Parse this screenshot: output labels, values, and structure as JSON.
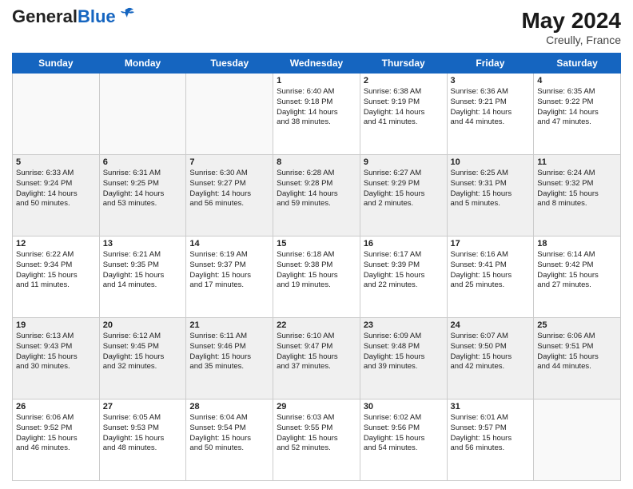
{
  "header": {
    "logo_general": "General",
    "logo_blue": "Blue",
    "month_year": "May 2024",
    "location": "Creully, France"
  },
  "days_of_week": [
    "Sunday",
    "Monday",
    "Tuesday",
    "Wednesday",
    "Thursday",
    "Friday",
    "Saturday"
  ],
  "weeks": [
    [
      {
        "day": "",
        "content": ""
      },
      {
        "day": "",
        "content": ""
      },
      {
        "day": "",
        "content": ""
      },
      {
        "day": "1",
        "content": "Sunrise: 6:40 AM\nSunset: 9:18 PM\nDaylight: 14 hours\nand 38 minutes."
      },
      {
        "day": "2",
        "content": "Sunrise: 6:38 AM\nSunset: 9:19 PM\nDaylight: 14 hours\nand 41 minutes."
      },
      {
        "day": "3",
        "content": "Sunrise: 6:36 AM\nSunset: 9:21 PM\nDaylight: 14 hours\nand 44 minutes."
      },
      {
        "day": "4",
        "content": "Sunrise: 6:35 AM\nSunset: 9:22 PM\nDaylight: 14 hours\nand 47 minutes."
      }
    ],
    [
      {
        "day": "5",
        "content": "Sunrise: 6:33 AM\nSunset: 9:24 PM\nDaylight: 14 hours\nand 50 minutes."
      },
      {
        "day": "6",
        "content": "Sunrise: 6:31 AM\nSunset: 9:25 PM\nDaylight: 14 hours\nand 53 minutes."
      },
      {
        "day": "7",
        "content": "Sunrise: 6:30 AM\nSunset: 9:27 PM\nDaylight: 14 hours\nand 56 minutes."
      },
      {
        "day": "8",
        "content": "Sunrise: 6:28 AM\nSunset: 9:28 PM\nDaylight: 14 hours\nand 59 minutes."
      },
      {
        "day": "9",
        "content": "Sunrise: 6:27 AM\nSunset: 9:29 PM\nDaylight: 15 hours\nand 2 minutes."
      },
      {
        "day": "10",
        "content": "Sunrise: 6:25 AM\nSunset: 9:31 PM\nDaylight: 15 hours\nand 5 minutes."
      },
      {
        "day": "11",
        "content": "Sunrise: 6:24 AM\nSunset: 9:32 PM\nDaylight: 15 hours\nand 8 minutes."
      }
    ],
    [
      {
        "day": "12",
        "content": "Sunrise: 6:22 AM\nSunset: 9:34 PM\nDaylight: 15 hours\nand 11 minutes."
      },
      {
        "day": "13",
        "content": "Sunrise: 6:21 AM\nSunset: 9:35 PM\nDaylight: 15 hours\nand 14 minutes."
      },
      {
        "day": "14",
        "content": "Sunrise: 6:19 AM\nSunset: 9:37 PM\nDaylight: 15 hours\nand 17 minutes."
      },
      {
        "day": "15",
        "content": "Sunrise: 6:18 AM\nSunset: 9:38 PM\nDaylight: 15 hours\nand 19 minutes."
      },
      {
        "day": "16",
        "content": "Sunrise: 6:17 AM\nSunset: 9:39 PM\nDaylight: 15 hours\nand 22 minutes."
      },
      {
        "day": "17",
        "content": "Sunrise: 6:16 AM\nSunset: 9:41 PM\nDaylight: 15 hours\nand 25 minutes."
      },
      {
        "day": "18",
        "content": "Sunrise: 6:14 AM\nSunset: 9:42 PM\nDaylight: 15 hours\nand 27 minutes."
      }
    ],
    [
      {
        "day": "19",
        "content": "Sunrise: 6:13 AM\nSunset: 9:43 PM\nDaylight: 15 hours\nand 30 minutes."
      },
      {
        "day": "20",
        "content": "Sunrise: 6:12 AM\nSunset: 9:45 PM\nDaylight: 15 hours\nand 32 minutes."
      },
      {
        "day": "21",
        "content": "Sunrise: 6:11 AM\nSunset: 9:46 PM\nDaylight: 15 hours\nand 35 minutes."
      },
      {
        "day": "22",
        "content": "Sunrise: 6:10 AM\nSunset: 9:47 PM\nDaylight: 15 hours\nand 37 minutes."
      },
      {
        "day": "23",
        "content": "Sunrise: 6:09 AM\nSunset: 9:48 PM\nDaylight: 15 hours\nand 39 minutes."
      },
      {
        "day": "24",
        "content": "Sunrise: 6:07 AM\nSunset: 9:50 PM\nDaylight: 15 hours\nand 42 minutes."
      },
      {
        "day": "25",
        "content": "Sunrise: 6:06 AM\nSunset: 9:51 PM\nDaylight: 15 hours\nand 44 minutes."
      }
    ],
    [
      {
        "day": "26",
        "content": "Sunrise: 6:06 AM\nSunset: 9:52 PM\nDaylight: 15 hours\nand 46 minutes."
      },
      {
        "day": "27",
        "content": "Sunrise: 6:05 AM\nSunset: 9:53 PM\nDaylight: 15 hours\nand 48 minutes."
      },
      {
        "day": "28",
        "content": "Sunrise: 6:04 AM\nSunset: 9:54 PM\nDaylight: 15 hours\nand 50 minutes."
      },
      {
        "day": "29",
        "content": "Sunrise: 6:03 AM\nSunset: 9:55 PM\nDaylight: 15 hours\nand 52 minutes."
      },
      {
        "day": "30",
        "content": "Sunrise: 6:02 AM\nSunset: 9:56 PM\nDaylight: 15 hours\nand 54 minutes."
      },
      {
        "day": "31",
        "content": "Sunrise: 6:01 AM\nSunset: 9:57 PM\nDaylight: 15 hours\nand 56 minutes."
      },
      {
        "day": "",
        "content": ""
      }
    ]
  ]
}
